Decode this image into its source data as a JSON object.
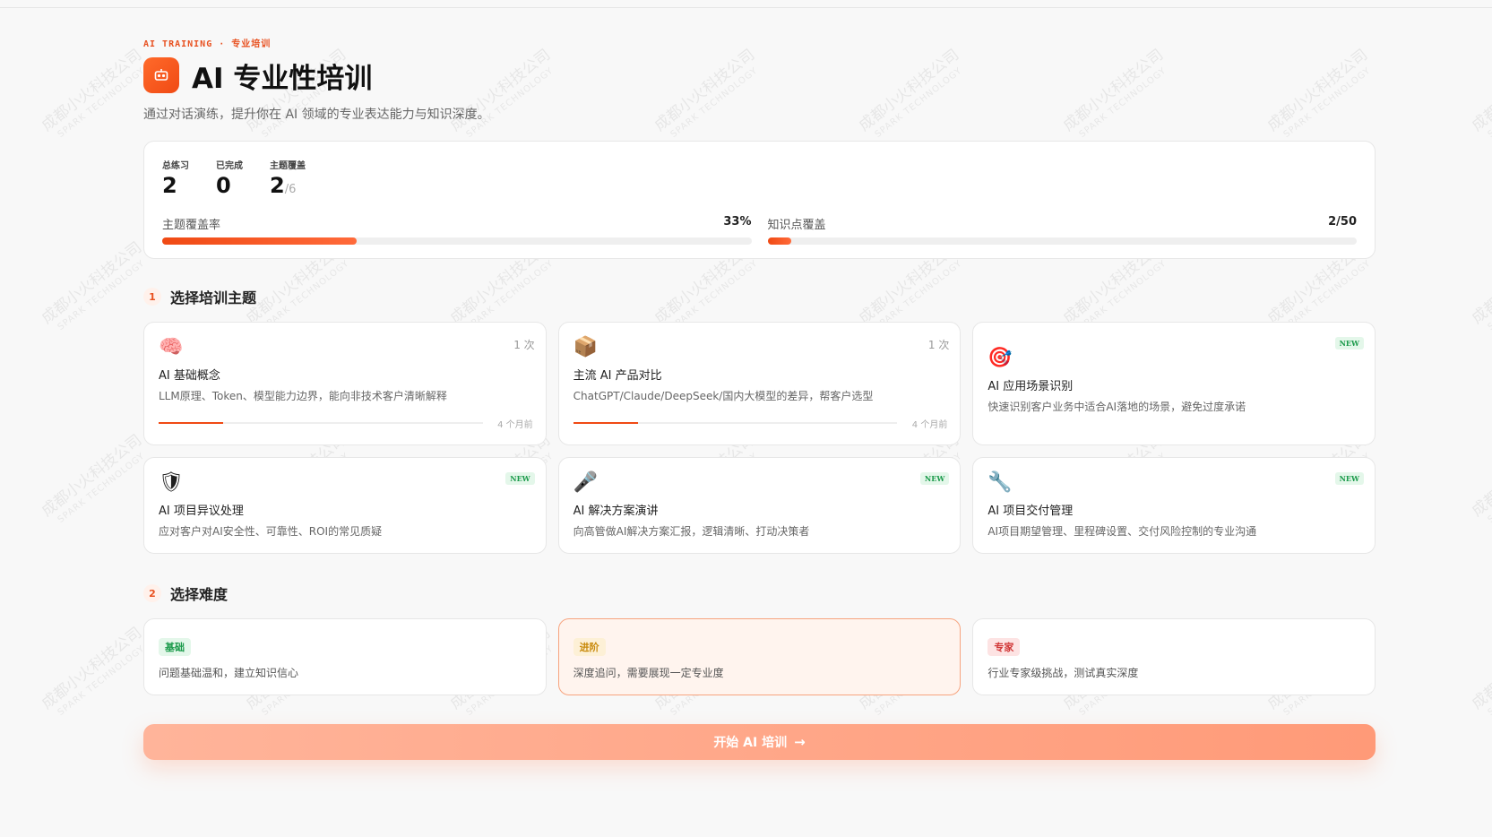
{
  "header": {
    "eyebrow": "AI TRAINING · 专业培训",
    "title": "AI 专业性培训",
    "subtitle": "通过对话演练，提升你在 AI 领域的专业表达能力与知识深度。"
  },
  "stats": {
    "total_label": "总练习",
    "total_value": "2",
    "done_label": "已完成",
    "done_value": "0",
    "topic_label": "主题覆盖",
    "topic_value": "2",
    "topic_total": "/6",
    "coverage_label": "主题覆盖率",
    "coverage_pct": "33%",
    "coverage_fraction": 0.33,
    "knowledge_label": "知识点覆盖",
    "knowledge_value": "2/50",
    "knowledge_fraction": 0.04
  },
  "topics_section": {
    "step": "1",
    "title": "选择培训主题"
  },
  "topics": [
    {
      "icon": "🧠",
      "icon_name": "brain-icon",
      "name": "AI 基础概念",
      "desc": "LLM原理、Token、模型能力边界，能向非技术客户清晰解释",
      "count": "1 次",
      "ago": "4 个月前",
      "progress": 0.2
    },
    {
      "icon": "📦",
      "icon_name": "package-icon",
      "name": "主流 AI 产品对比",
      "desc": "ChatGPT/Claude/DeepSeek/国内大模型的差异，帮客户选型",
      "count": "1 次",
      "ago": "4 个月前",
      "progress": 0.2
    },
    {
      "icon": "🎯",
      "icon_name": "target-icon",
      "name": "AI 应用场景识别",
      "desc": "快速识别客户业务中适合AI落地的场景，避免过度承诺",
      "badge": "NEW"
    },
    {
      "icon": "🛡",
      "icon_name": "shield-icon",
      "name": "AI 项目异议处理",
      "desc": "应对客户对AI安全性、可靠性、ROI的常见质疑",
      "badge": "NEW"
    },
    {
      "icon": "🎤",
      "icon_name": "microphone-icon",
      "name": "AI 解决方案演讲",
      "desc": "向高管做AI解决方案汇报，逻辑清晰、打动决策者",
      "badge": "NEW"
    },
    {
      "icon": "🔧",
      "icon_name": "wrench-icon",
      "name": "AI 项目交付管理",
      "desc": "AI项目期望管理、里程碑设置、交付风险控制的专业沟通",
      "badge": "NEW"
    }
  ],
  "difficulty_section": {
    "step": "2",
    "title": "选择难度"
  },
  "difficulties": [
    {
      "tag": "基础",
      "desc": "问题基础温和，建立知识信心"
    },
    {
      "tag": "进阶",
      "desc": "深度追问，需要展现一定专业度",
      "selected": true
    },
    {
      "tag": "专家",
      "desc": "行业专家级挑战，测试真实深度"
    }
  ],
  "start_button": {
    "label": "开始 AI 培训",
    "arrow": "→"
  },
  "watermark": {
    "line1": "成都小火科技公司",
    "line2": "SPARK TECHNOLOGY"
  },
  "colors": {
    "accent": "#f04a14",
    "new_badge": "#1a9a4a"
  }
}
